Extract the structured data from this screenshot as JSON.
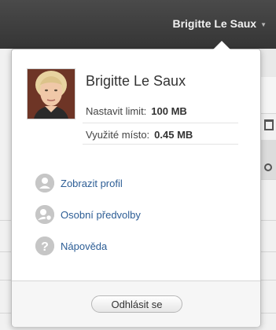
{
  "header": {
    "user_name": "Brigitte Le Saux"
  },
  "popup": {
    "name": "Brigitte Le Saux",
    "quota": [
      {
        "label": "Nastavit limit:",
        "value": "100 MB"
      },
      {
        "label": "Využité místo:",
        "value": "0.45 MB"
      }
    ],
    "menu": [
      {
        "label": "Zobrazit profil",
        "icon": "user-icon"
      },
      {
        "label": "Osobní předvolby",
        "icon": "user-settings-icon"
      },
      {
        "label": "Nápověda",
        "icon": "help-icon"
      }
    ],
    "logout_label": "Odhlásit se"
  },
  "colors": {
    "topbar": "#3d3d3d",
    "link": "#2c5d95",
    "icon": "#c6c6c6"
  }
}
